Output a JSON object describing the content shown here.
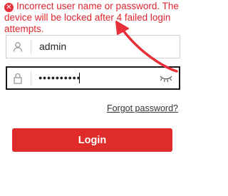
{
  "error": {
    "line1": "Incorrect user name or password. The",
    "line2": "device will be locked after 4 failed login",
    "line3": "attempts."
  },
  "username": {
    "value": "admin",
    "icon": "user-icon"
  },
  "password": {
    "masked_value": "●●●●●●●●●●",
    "icon": "lock-icon",
    "toggle_icon": "eye-closed-icon"
  },
  "forgot_password": {
    "label": "Forgot password?"
  },
  "login_button": {
    "label": "Login"
  },
  "colors": {
    "error": "#e0262f",
    "button": "#e02b2b",
    "annotation": "#e8303a"
  }
}
